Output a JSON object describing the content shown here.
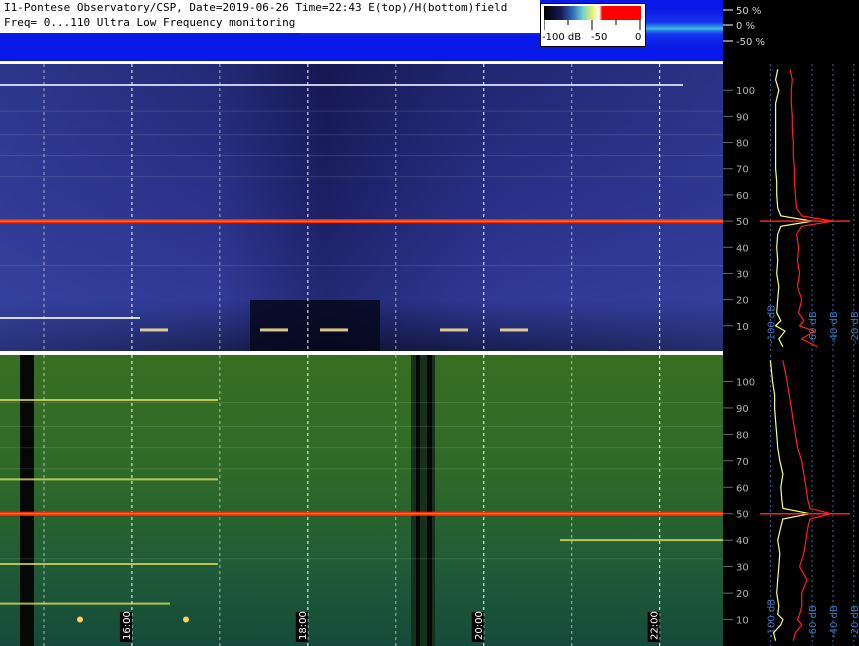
{
  "header": {
    "title_line_1": "I1-Pontese Observatory/CSP, Date=2019-06-26 Time=22:43 E(top)/H(bottom)field",
    "title_line_2": "Freq= 0...110 Ultra Low Frequency monitoring"
  },
  "colorbar": {
    "labels": [
      "-100 dB",
      "-50",
      "0"
    ]
  },
  "amplitude_axis": {
    "labels": [
      "50 %",
      "0 %",
      "-50 %"
    ]
  },
  "chart_data": [
    {
      "type": "heatmap",
      "name": "E field spectrogram (top)",
      "y_ticks": [
        10,
        20,
        30,
        40,
        50,
        60,
        70,
        80,
        90,
        100
      ],
      "ylim": [
        0,
        110
      ],
      "time_ticks": [
        "16:00",
        "18:00",
        "20:00",
        "22:00"
      ],
      "x_hours": [
        16,
        18,
        20,
        22
      ],
      "time_range_hours": [
        14.5,
        22.72
      ],
      "dominant_line_hz": 50,
      "colormap": "blue-white-red"
    },
    {
      "type": "heatmap",
      "name": "H field spectrogram (bottom)",
      "y_ticks": [
        10,
        20,
        30,
        40,
        50,
        60,
        70,
        80,
        90,
        100
      ],
      "ylim": [
        0,
        110
      ],
      "time_ticks": [
        "16:00",
        "18:00",
        "20:00",
        "22:00"
      ],
      "x_hours": [
        16,
        18,
        20,
        22
      ],
      "time_range_hours": [
        14.5,
        22.72
      ],
      "dominant_line_hz": 50,
      "colormap": "green-yellow-red"
    },
    {
      "type": "line",
      "name": "E field spectrum profile",
      "x_ticks": [
        "-100 dB",
        "-60 dB",
        "-40 dB",
        "-20 dB"
      ],
      "series": [
        {
          "color": "#ffff80",
          "y": [
            2,
            5,
            8,
            10,
            12,
            15,
            20,
            25,
            30,
            35,
            40,
            45,
            48,
            50,
            52,
            55,
            60,
            65,
            70,
            75,
            80,
            85,
            90,
            95,
            100,
            104,
            108
          ],
          "x_db": [
            -88,
            -92,
            -86,
            -95,
            -90,
            -94,
            -93,
            -92,
            -94,
            -93,
            -94,
            -93,
            -90,
            -60,
            -90,
            -93,
            -94,
            -94,
            -95,
            -95,
            -95,
            -95,
            -95,
            -95,
            -92,
            -95,
            -93
          ]
        },
        {
          "color": "#ff2020",
          "y": [
            2,
            5,
            8,
            10,
            12,
            15,
            20,
            25,
            30,
            35,
            40,
            45,
            48,
            50,
            52,
            55,
            60,
            65,
            70,
            75,
            80,
            85,
            90,
            95,
            100,
            104,
            108
          ],
          "x_db": [
            -55,
            -70,
            -58,
            -72,
            -68,
            -73,
            -70,
            -74,
            -72,
            -74,
            -73,
            -75,
            -70,
            -40,
            -70,
            -75,
            -76,
            -77,
            -77,
            -78,
            -78,
            -79,
            -79,
            -80,
            -80,
            -79,
            -81
          ]
        }
      ]
    },
    {
      "type": "line",
      "name": "H field spectrum profile",
      "x_ticks": [
        "-100 dB",
        "-60 dB",
        "-40 dB",
        "-20 dB"
      ],
      "series": [
        {
          "color": "#ffff80",
          "y": [
            2,
            5,
            8,
            10,
            12,
            15,
            20,
            25,
            30,
            35,
            40,
            45,
            48,
            50,
            52,
            55,
            60,
            65,
            70,
            75,
            80,
            85,
            90,
            95,
            100,
            104,
            108
          ],
          "x_db": [
            -95,
            -97,
            -90,
            -88,
            -93,
            -92,
            -94,
            -93,
            -92,
            -91,
            -93,
            -90,
            -88,
            -62,
            -88,
            -89,
            -90,
            -88,
            -91,
            -93,
            -94,
            -95,
            -96,
            -96,
            -98,
            -99,
            -100
          ]
        },
        {
          "color": "#ff2020",
          "y": [
            2,
            5,
            8,
            10,
            12,
            15,
            20,
            25,
            30,
            35,
            40,
            45,
            48,
            50,
            52,
            55,
            60,
            65,
            70,
            75,
            80,
            85,
            90,
            95,
            100,
            104,
            108
          ],
          "x_db": [
            -78,
            -76,
            -70,
            -74,
            -72,
            -70,
            -70,
            -65,
            -72,
            -68,
            -66,
            -64,
            -62,
            -42,
            -62,
            -64,
            -66,
            -68,
            -70,
            -74,
            -76,
            -78,
            -80,
            -82,
            -84,
            -86,
            -88
          ]
        }
      ]
    }
  ]
}
